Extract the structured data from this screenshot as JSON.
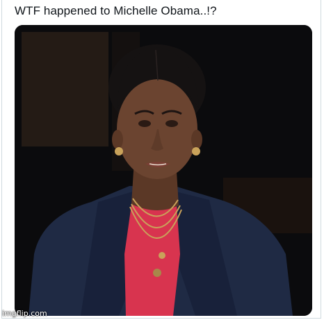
{
  "post": {
    "text": "WTF happened to Michelle Obama..!?"
  },
  "media": {
    "description_icon": "photo-portrait",
    "colors": {
      "background": "#0b0b0d",
      "jacket": "#1f2a44",
      "top": "#d8344f",
      "skin": "#6b4430",
      "hair": "#151212",
      "jewelry": "#c9a25a"
    }
  },
  "watermark": {
    "text": "imgflip.com"
  }
}
